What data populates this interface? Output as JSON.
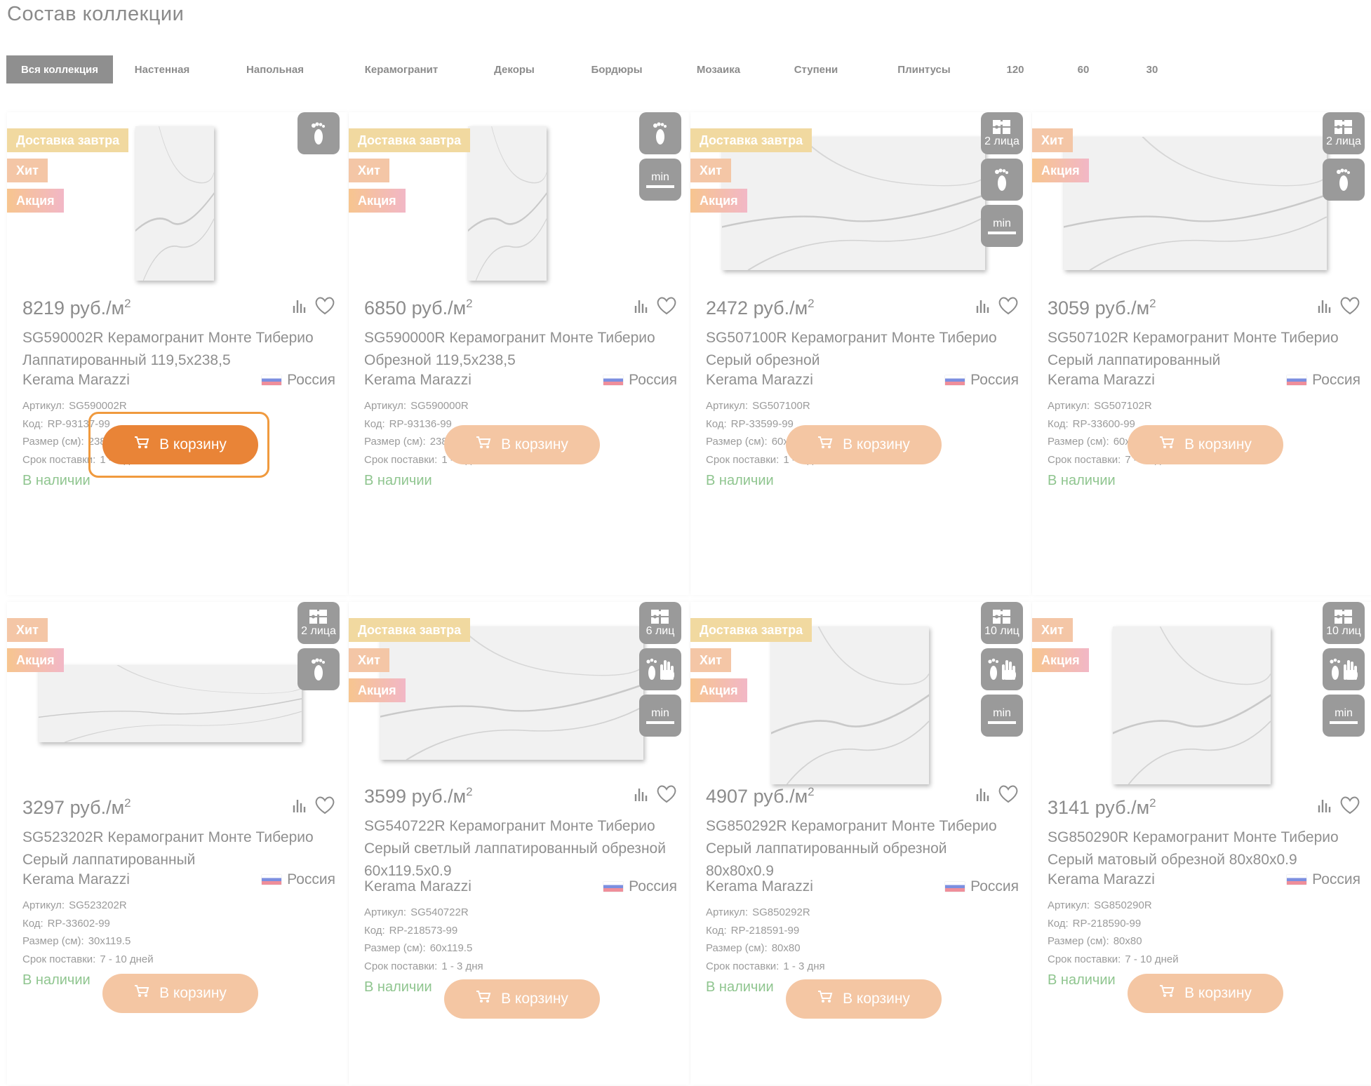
{
  "page": {
    "title": "Состав коллекции"
  },
  "tabs": [
    {
      "label": "Вся коллекция",
      "active": true
    },
    {
      "label": "Настенная"
    },
    {
      "label": "Напольная"
    },
    {
      "label": "Керамогранит"
    },
    {
      "label": "Декоры"
    },
    {
      "label": "Бордюры"
    },
    {
      "label": "Мозаика"
    },
    {
      "label": "Ступени"
    },
    {
      "label": "Плинтусы"
    },
    {
      "label": "120"
    },
    {
      "label": "60"
    },
    {
      "label": "30"
    }
  ],
  "labels": {
    "delivery": "Доставка завтра",
    "hit": "Хит",
    "sale": "Акция",
    "article": "Артикул:",
    "code": "Код:",
    "size": "Размер (см):",
    "term": "Срок поставки:",
    "in_stock": "В наличии",
    "to_cart": "В корзину",
    "min": "min",
    "unit": "руб./м",
    "unit_sup": "2"
  },
  "cards": [
    {
      "price": "8219",
      "name": "SG590002R Керамогранит Монте Тиберио Лаппатированный 119,5x238,5",
      "brand": "Kerama Marazzi",
      "country": "Россия",
      "article": "SG590002R",
      "code": "RP-93137-99",
      "size": "238.5x119.5",
      "term": "1 - 3 дня",
      "faces": ""
    },
    {
      "price": "6850",
      "name": "SG590000R Керамогранит Монте Тиберио Обрезной 119,5x238,5",
      "brand": "Kerama Marazzi",
      "country": "Россия",
      "article": "SG590000R",
      "code": "RP-93136-99",
      "size": "238.5x119.5",
      "term": "1 - 3 дня",
      "faces": ""
    },
    {
      "price": "2472",
      "name": "SG507100R Керамогранит Монте Тиберио Серый обрезной",
      "brand": "Kerama Marazzi",
      "country": "Россия",
      "article": "SG507100R",
      "code": "RP-33599-99",
      "size": "60x119.5",
      "term": "1 - 3 дня",
      "faces": "2 лица"
    },
    {
      "price": "3059",
      "name": "SG507102R Керамогранит Монте Тиберио Серый лаппатированный",
      "brand": "Kerama Marazzi",
      "country": "Россия",
      "article": "SG507102R",
      "code": "RP-33600-99",
      "size": "60x119.5",
      "term": "7 - 10 дней",
      "faces": "2 лица"
    },
    {
      "price": "3297",
      "name": "SG523202R Керамогранит Монте Тиберио Серый лаппатированный",
      "brand": "Kerama Marazzi",
      "country": "Россия",
      "article": "SG523202R",
      "code": "RP-33602-99",
      "size": "30x119.5",
      "term": "7 - 10 дней",
      "faces": "2 лица"
    },
    {
      "price": "3599",
      "name": "SG540722R Керамогранит Монте Тиберио Серый светлый лаппатированный обрезной 60x119.5x0.9",
      "brand": "Kerama Marazzi",
      "country": "Россия",
      "article": "SG540722R",
      "code": "RP-218573-99",
      "size": "60x119.5",
      "term": "1 - 3 дня",
      "faces": "6 лиц"
    },
    {
      "price": "4907",
      "name": "SG850292R Керамогранит Монте Тиберио Серый лаппатированный обрезной 80x80x0.9",
      "brand": "Kerama Marazzi",
      "country": "Россия",
      "article": "SG850292R",
      "code": "RP-218591-99",
      "size": "80x80",
      "term": "1 - 3 дня",
      "faces": "10 лиц"
    },
    {
      "price": "3141",
      "name": "SG850290R Керамогранит Монте Тиберио Серый матовый обрезной 80x80x0.9",
      "brand": "Kerama Marazzi",
      "country": "Россия",
      "article": "SG850290R",
      "code": "RP-218590-99",
      "size": "80x80",
      "term": "7 - 10 дней",
      "faces": "10 лиц"
    }
  ]
}
